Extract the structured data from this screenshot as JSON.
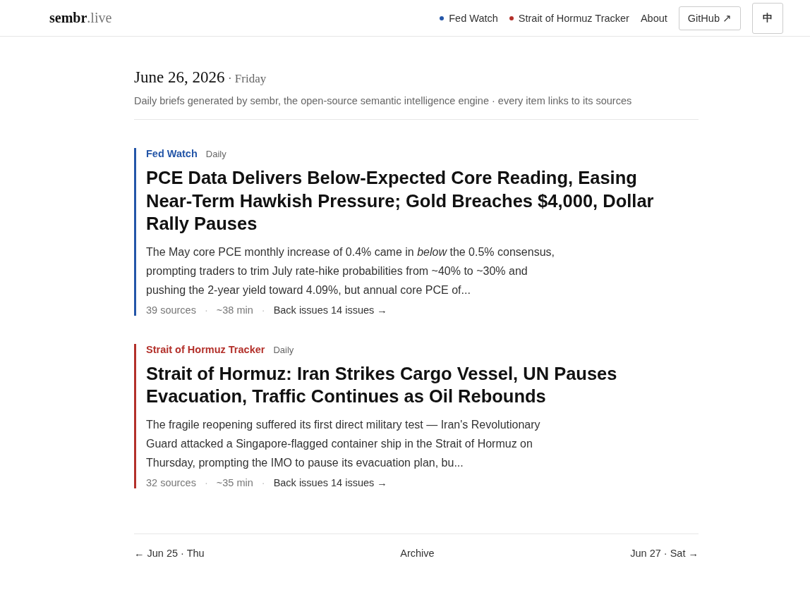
{
  "header": {
    "logo": "**sembr**.live",
    "nav": [
      {
        "label": "Fed Watch",
        "color": "#2456a8"
      },
      {
        "label": "Strait of Hormuz Tracker",
        "color": "#b3302a"
      },
      {
        "label": "About"
      }
    ],
    "github_button": "GitHub ↗",
    "language_button": "中"
  },
  "intro": {
    "date": "June 26, 2026",
    "weekday": "· Friday",
    "tagline": "Daily briefs generated by sembr, the open-source semantic intelligence engine · every item links to its sources"
  },
  "briefs": [
    {
      "section": "Fed Watch",
      "color": "#2456a8",
      "frequency": "Daily",
      "title": "PCE Data Delivers Below-Expected Core Reading, Easing Near-Term Hawkish Pressure; Gold Breaches $4,000, Dollar Rally Pauses",
      "summary": "The May core PCE monthly increase of 0.4% came in *below* the 0.5% consensus, prompting traders to trim July rate-hike probabilities from ~40% to ~30% and pushing the 2-year yield toward 4.09%, but annual core PCE of...",
      "meta": [
        {
          "kind": "text",
          "text": "39 sources"
        },
        {
          "kind": "sep",
          "text": "·"
        },
        {
          "kind": "text",
          "text": "~38 min"
        },
        {
          "kind": "sep",
          "text": "·"
        },
        {
          "kind": "link",
          "text": "Back issues 14 issues →"
        }
      ]
    },
    {
      "section": "Strait of Hormuz Tracker",
      "color": "#b3302a",
      "frequency": "Daily",
      "title": "Strait of Hormuz: Iran Strikes Cargo Vessel, UN Pauses Evacuation, Traffic Continues as Oil Rebounds",
      "summary": "The fragile reopening suffered its first direct military test — Iran's Revolutionary Guard attacked a Singapore-flagged container ship in the Strait of Hormuz on Thursday, prompting the IMO to pause its evacuation plan, bu...",
      "meta": [
        {
          "kind": "text",
          "text": "32 sources"
        },
        {
          "kind": "sep",
          "text": "·"
        },
        {
          "kind": "text",
          "text": "~35 min"
        },
        {
          "kind": "sep",
          "text": "·"
        },
        {
          "kind": "link",
          "text": "Back issues 14 issues →"
        }
      ]
    }
  ],
  "pager": {
    "previous": "← Jun 25 · Thu",
    "archive": "Archive",
    "next": "Jun 27 · Sat →"
  }
}
